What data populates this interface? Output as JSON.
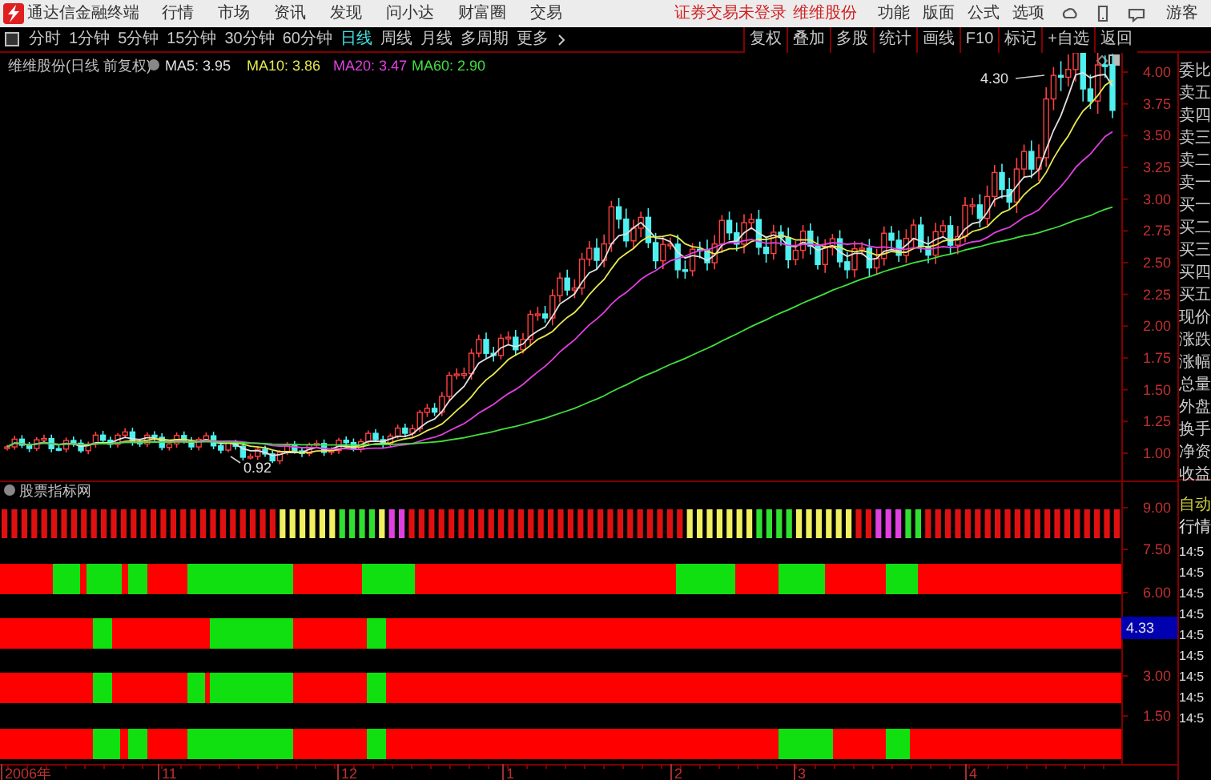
{
  "app": {
    "title": "通达信金融终端",
    "menu": [
      "行情",
      "市场",
      "资讯",
      "发现",
      "问小达",
      "财富圈",
      "交易"
    ],
    "login_status": "证券交易未登录",
    "stock_name": "维维股份",
    "right_menu": [
      "功能",
      "版面",
      "公式",
      "选项"
    ],
    "user": "游客"
  },
  "periods": [
    {
      "label": "分时",
      "selected": false
    },
    {
      "label": "1分钟",
      "selected": false
    },
    {
      "label": "5分钟",
      "selected": false
    },
    {
      "label": "15分钟",
      "selected": false
    },
    {
      "label": "30分钟",
      "selected": false
    },
    {
      "label": "60分钟",
      "selected": false
    },
    {
      "label": "日线",
      "selected": true
    },
    {
      "label": "周线",
      "selected": false
    },
    {
      "label": "月线",
      "selected": false
    },
    {
      "label": "多周期",
      "selected": false
    },
    {
      "label": "更多",
      "selected": false
    }
  ],
  "tools": [
    "复权",
    "叠加",
    "多股",
    "统计",
    "画线",
    "F10",
    "标记",
    "+自选",
    "返回"
  ],
  "price_chart": {
    "title": "维维股份(日线 前复权)",
    "ma": [
      {
        "label": "MA5: 3.95",
        "color": "#e0e0e0"
      },
      {
        "label": "MA10: 3.86",
        "color": "#e8e850"
      },
      {
        "label": "MA20: 3.47",
        "color": "#e040e0"
      },
      {
        "label": "MA60: 2.90",
        "color": "#40e040"
      }
    ],
    "y_labels": [
      "4.00",
      "3.75",
      "3.50",
      "3.25",
      "3.00",
      "2.75",
      "2.50",
      "2.25",
      "2.00",
      "1.75",
      "1.50",
      "1.25",
      "1.00"
    ],
    "high_label": "4.30",
    "low_label": "0.92"
  },
  "indicator": {
    "title": "股票指标网",
    "y_labels": [
      {
        "text": "9.00",
        "kind": "tick"
      },
      {
        "text": "7.50",
        "kind": "tick"
      },
      {
        "text": "6.00",
        "kind": "tick"
      },
      {
        "text": "4.33",
        "kind": "cursor"
      },
      {
        "text": "3.00",
        "kind": "tick"
      },
      {
        "text": "1.50",
        "kind": "tick"
      }
    ]
  },
  "x_labels": [
    "2006年",
    "11",
    "12",
    "1",
    "2",
    "3",
    "4"
  ],
  "quote_panel": {
    "labels": [
      "委比",
      "卖五",
      "卖四",
      "卖三",
      "卖二",
      "卖一",
      "买一",
      "买二",
      "买三",
      "买四",
      "买五",
      "现价",
      "涨跌",
      "涨幅",
      "总量",
      "外盘",
      "换手",
      "净资",
      "收益"
    ],
    "mode": "自动",
    "tab": "行情",
    "times": [
      "14:5",
      "14:5",
      "14:5",
      "14:5",
      "14:5",
      "14:5",
      "14:5",
      "14:5",
      "14:5"
    ]
  }
}
